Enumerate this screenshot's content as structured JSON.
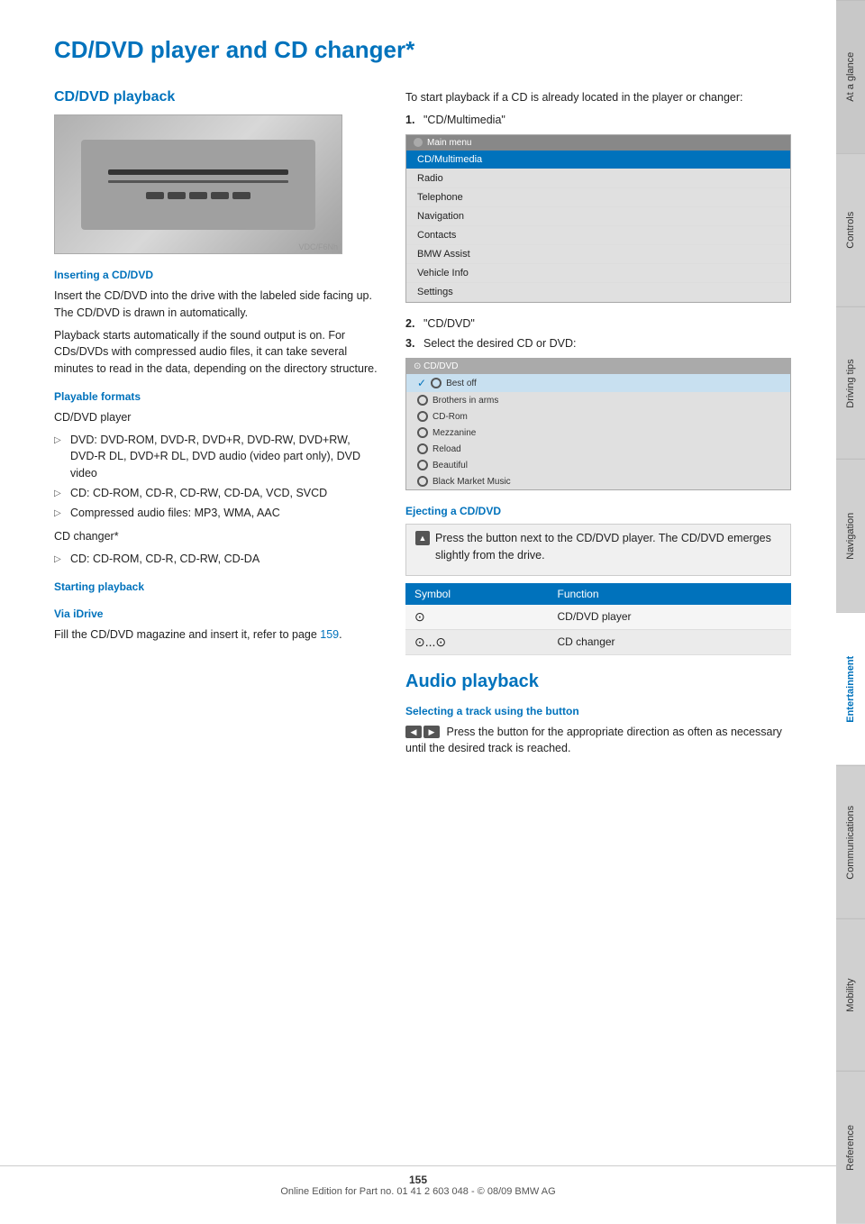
{
  "page": {
    "title": "CD/DVD player and CD changer*",
    "page_number": "155",
    "footer_text": "Online Edition for Part no. 01 41 2 603 048 - © 08/09 BMW AG"
  },
  "sidebar": {
    "tabs": [
      {
        "label": "At a glance",
        "active": false
      },
      {
        "label": "Controls",
        "active": false
      },
      {
        "label": "Driving tips",
        "active": false
      },
      {
        "label": "Navigation",
        "active": false
      },
      {
        "label": "Entertainment",
        "active": true
      },
      {
        "label": "Communications",
        "active": false
      },
      {
        "label": "Mobility",
        "active": false
      },
      {
        "label": "Reference",
        "active": false
      }
    ]
  },
  "left_column": {
    "section1_heading": "CD/DVD playback",
    "inserting_heading": "Inserting a CD/DVD",
    "inserting_text1": "Insert the CD/DVD into the drive with the labeled side facing up. The CD/DVD is drawn in automatically.",
    "inserting_text2": "Playback starts automatically if the sound output is on. For CDs/DVDs with compressed audio files, it can take several minutes to read in the data, depending on the directory structure.",
    "formats_heading": "Playable formats",
    "formats_cddvd": "CD/DVD player",
    "formats_dvd_label": "DVD: DVD-ROM, DVD-R, DVD+R, DVD-RW, DVD+RW, DVD-R DL, DVD+R DL, DVD audio (video part only), DVD video",
    "formats_cd_label": "CD: CD-ROM, CD-R, CD-RW, CD-DA, VCD, SVCD",
    "formats_compressed_label": "Compressed audio files: MP3, WMA, AAC",
    "formats_cdchanger": "CD changer*",
    "formats_cdchanger_cd": "CD: CD-ROM, CD-R, CD-RW, CD-DA",
    "starting_heading": "Starting playback",
    "via_idrive_heading": "Via iDrive",
    "via_idrive_text": "Fill the CD/DVD magazine and insert it, refer to page",
    "via_idrive_page": "159",
    "via_idrive_period": "."
  },
  "right_column": {
    "intro_text": "To start playback if a CD is already located in the player or changer:",
    "step1": "\"CD/Multimedia\"",
    "step2": "\"CD/DVD\"",
    "step3": "Select the desired CD or DVD:",
    "main_menu": {
      "title": "Main menu",
      "items": [
        {
          "label": "CD/Multimedia",
          "highlight": true
        },
        {
          "label": "Radio",
          "highlight": false
        },
        {
          "label": "Telephone",
          "highlight": false
        },
        {
          "label": "Navigation",
          "highlight": false
        },
        {
          "label": "Contacts",
          "highlight": false
        },
        {
          "label": "BMW Assist",
          "highlight": false
        },
        {
          "label": "Vehicle Info",
          "highlight": false
        },
        {
          "label": "Settings",
          "highlight": false
        }
      ]
    },
    "cd_menu": {
      "title": "CD/DVD",
      "items": [
        {
          "label": "Best off",
          "selected": true
        },
        {
          "label": "Brothers in arms"
        },
        {
          "label": "CD-Rom"
        },
        {
          "label": "Mezzanine"
        },
        {
          "label": "Reload"
        },
        {
          "label": "Beautiful"
        },
        {
          "label": "Black Market Music"
        }
      ]
    },
    "ejecting_heading": "Ejecting a CD/DVD",
    "ejecting_text": "Press the button next to the CD/DVD player. The CD/DVD emerges slightly from the drive.",
    "table": {
      "col1": "Symbol",
      "col2": "Function",
      "rows": [
        {
          "symbol": "⊙",
          "function": "CD/DVD player"
        },
        {
          "symbol": "⊙...⊙",
          "function": "CD changer"
        }
      ]
    },
    "audio_heading": "Audio playback",
    "selecting_heading": "Selecting a track using the button",
    "selecting_text": "Press the button for the appropriate direction as often as necessary until the desired track is reached."
  }
}
